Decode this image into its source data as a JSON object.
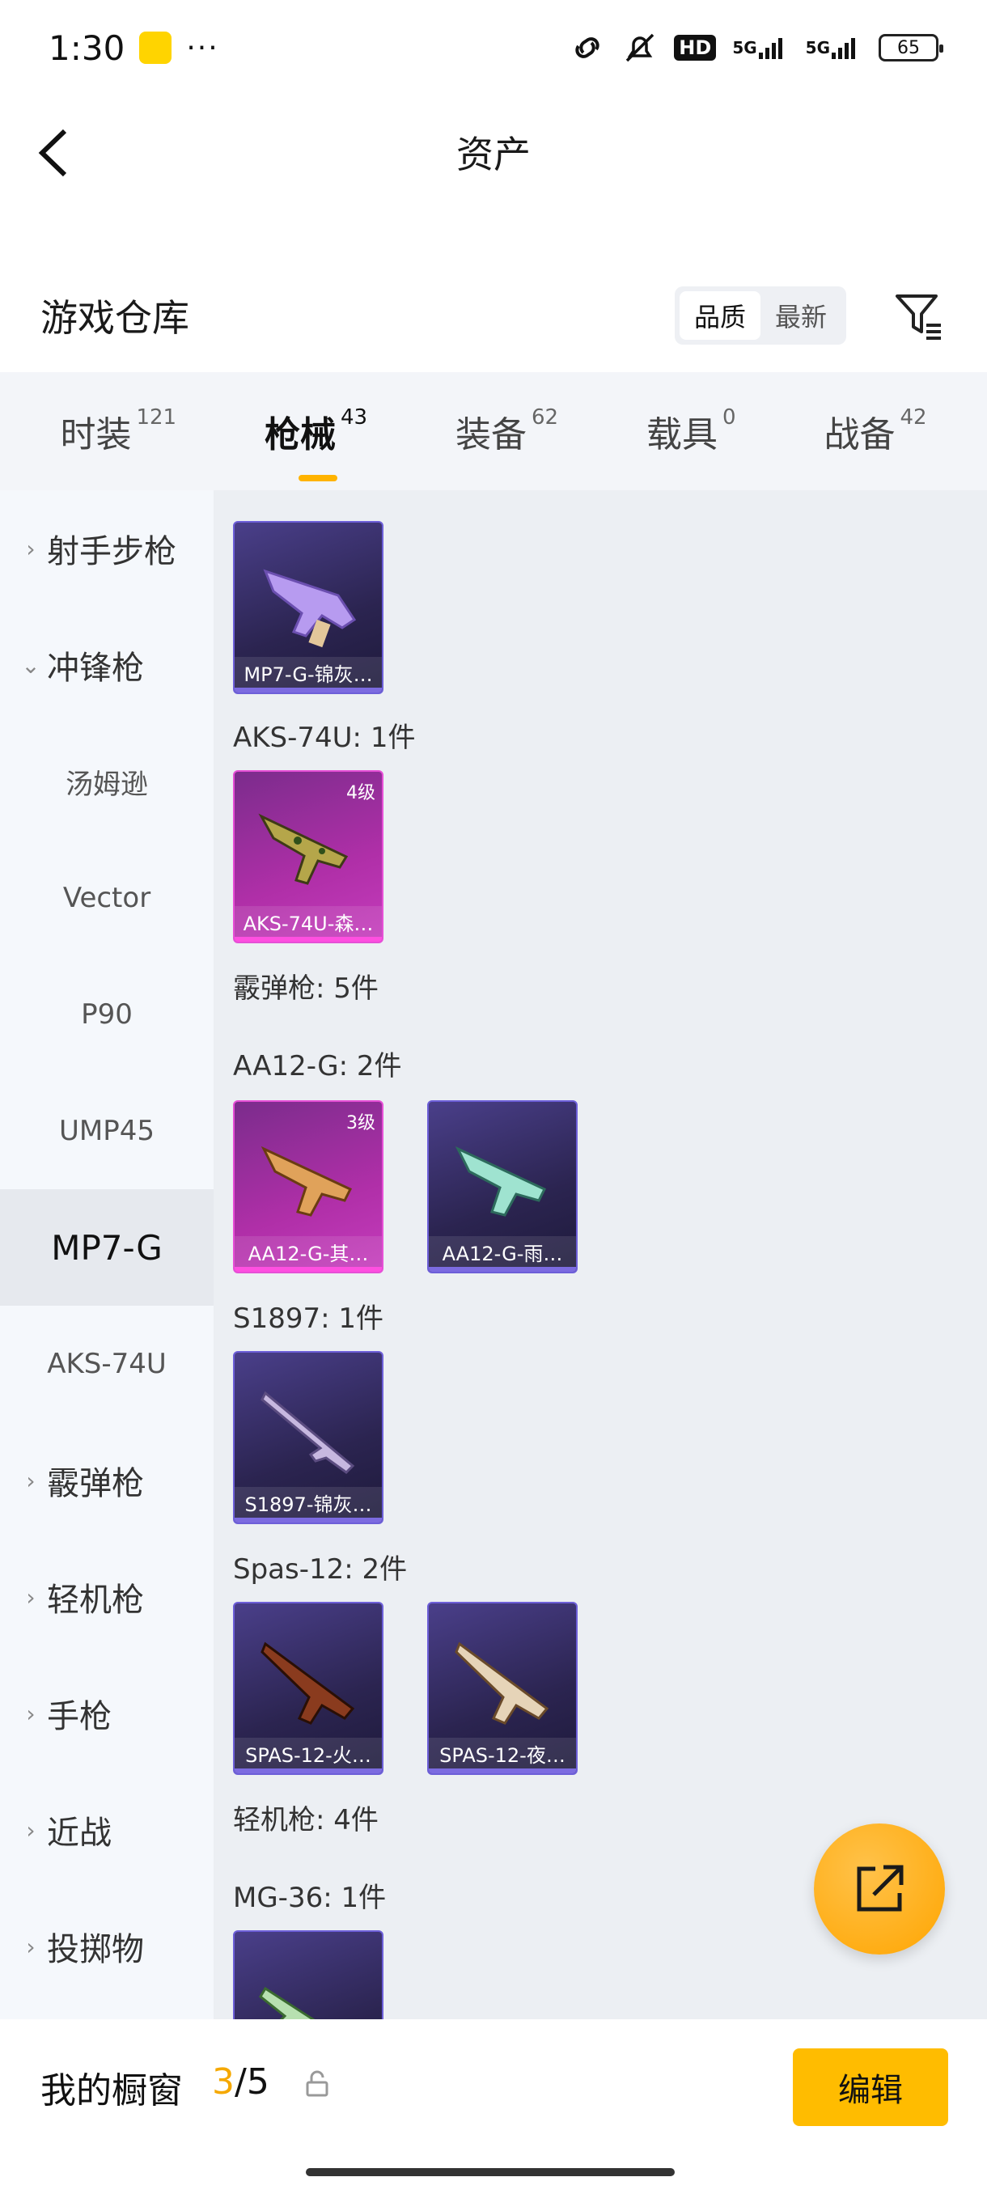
{
  "status_bar": {
    "time": "1:30",
    "dots": "···",
    "hd": "HD",
    "net1": "5G",
    "net2": "5G",
    "battery": "65"
  },
  "header": {
    "title": "资产"
  },
  "section": {
    "title": "游戏仓库",
    "sort_options": [
      "品质",
      "最新"
    ]
  },
  "tabs": [
    {
      "label": "时装",
      "count": "121"
    },
    {
      "label": "枪械",
      "count": "43"
    },
    {
      "label": "装备",
      "count": "62"
    },
    {
      "label": "载具",
      "count": "0"
    },
    {
      "label": "战备",
      "count": "42"
    }
  ],
  "sidebar": {
    "items": [
      {
        "label": "射手步枪",
        "type": "category",
        "expanded": false
      },
      {
        "label": "冲锋枪",
        "type": "category",
        "expanded": true
      },
      {
        "label": "汤姆逊",
        "type": "sub"
      },
      {
        "label": "Vector",
        "type": "sub"
      },
      {
        "label": "P90",
        "type": "sub"
      },
      {
        "label": "UMP45",
        "type": "sub"
      },
      {
        "label": "MP7-G",
        "type": "sub",
        "selected": true
      },
      {
        "label": "AKS-74U",
        "type": "sub"
      },
      {
        "label": "霰弹枪",
        "type": "category",
        "expanded": false
      },
      {
        "label": "轻机枪",
        "type": "category",
        "expanded": false
      },
      {
        "label": "手枪",
        "type": "category",
        "expanded": false
      },
      {
        "label": "近战",
        "type": "category",
        "expanded": false
      },
      {
        "label": "投掷物",
        "type": "category",
        "expanded": false
      }
    ]
  },
  "main": {
    "group_labels": [
      "AKS-74U: 1件",
      "霰弹枪: 5件",
      "AA12-G: 2件",
      "S1897: 1件",
      "Spas-12: 2件",
      "轻机枪: 4件",
      "MG-36: 1件"
    ],
    "cards": [
      {
        "name": "MP7-G-锦灰…",
        "level": "",
        "color": "purple"
      },
      {
        "name": "AKS-74U-森…",
        "level": "4级",
        "color": "pink"
      },
      {
        "name": "AA12-G-其…",
        "level": "3级",
        "color": "pink"
      },
      {
        "name": "AA12-G-雨…",
        "level": "",
        "color": "purple"
      },
      {
        "name": "S1897-锦灰…",
        "level": "",
        "color": "purple"
      },
      {
        "name": "SPAS-12-火…",
        "level": "",
        "color": "purple"
      },
      {
        "name": "SPAS-12-夜…",
        "level": "",
        "color": "purple"
      },
      {
        "name": "",
        "level": "",
        "color": "purple"
      }
    ]
  },
  "bottom": {
    "label": "我的橱窗",
    "current": "3",
    "total": "/5",
    "edit_label": "编辑"
  },
  "colors": {
    "accent": "#ffbc00",
    "sidebar_bg": "#f5f8fc",
    "main_bg": "#eceff3"
  }
}
